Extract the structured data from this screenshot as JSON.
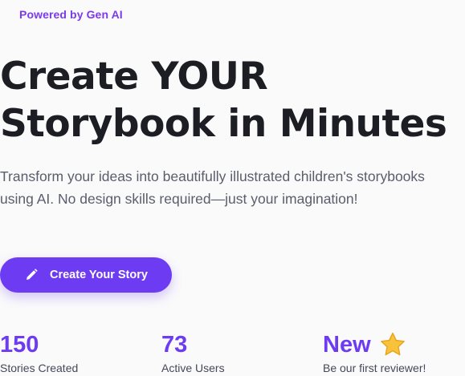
{
  "badge": "Powered by Gen AI",
  "hero": {
    "title_line1": "Create YOUR",
    "title_line2": "Storybook in Minutes",
    "subtitle": "Transform your ideas into beautifully illustrated children's storybooks using AI. No design skills required—just your imagination!"
  },
  "cta": {
    "label": "Create Your Story",
    "icon": "pencil-icon"
  },
  "stats": [
    {
      "value": "150",
      "caption": "Stories Created"
    },
    {
      "value": "73",
      "caption": "Active Users"
    },
    {
      "value": "New",
      "caption": "Be our first reviewer!",
      "icon": "star-icon"
    }
  ],
  "colors": {
    "accent": "#6d3cf2",
    "badge": "#7c3aed",
    "heading": "#1d1d24",
    "body": "#5a5d6b",
    "star": "#f8c23a"
  }
}
